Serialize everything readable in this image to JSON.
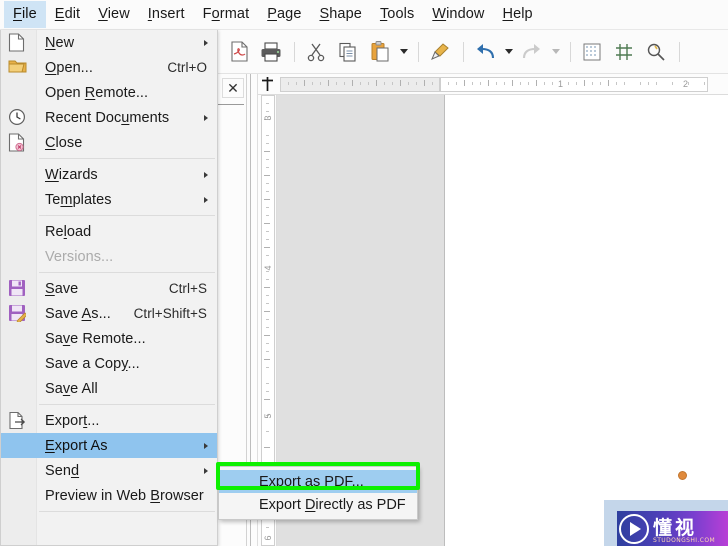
{
  "app": {
    "menubar": [
      {
        "label": "File",
        "mnemonic": "F",
        "active": true
      },
      {
        "label": "Edit",
        "mnemonic": "E",
        "active": false
      },
      {
        "label": "View",
        "mnemonic": "V",
        "active": false
      },
      {
        "label": "Insert",
        "mnemonic": "I",
        "active": false
      },
      {
        "label": "Format",
        "mnemonic": "o",
        "active": false
      },
      {
        "label": "Page",
        "mnemonic": "P",
        "active": false
      },
      {
        "label": "Shape",
        "mnemonic": "S",
        "active": false
      },
      {
        "label": "Tools",
        "mnemonic": "T",
        "active": false
      },
      {
        "label": "Window",
        "mnemonic": "W",
        "active": false
      },
      {
        "label": "Help",
        "mnemonic": "H",
        "active": false
      }
    ]
  },
  "toolbar": {
    "buttons": [
      {
        "icon": "export-pdf-icon",
        "tooltip": "Export as PDF"
      },
      {
        "icon": "print-icon",
        "tooltip": "Print"
      },
      {
        "icon": "cut-icon",
        "tooltip": "Cut"
      },
      {
        "icon": "copy-icon",
        "tooltip": "Copy"
      },
      {
        "icon": "paste-icon",
        "tooltip": "Paste"
      },
      {
        "icon": "clone-formatting-icon",
        "tooltip": "Clone Formatting"
      },
      {
        "icon": "undo-icon",
        "tooltip": "Undo"
      },
      {
        "icon": "redo-icon",
        "tooltip": "Redo"
      },
      {
        "icon": "display-grid-icon",
        "tooltip": "Display Grid"
      },
      {
        "icon": "snap-to-grid-icon",
        "tooltip": "Snap to Grid"
      },
      {
        "icon": "zoom-icon",
        "tooltip": "Zoom"
      }
    ]
  },
  "sidepanel": {
    "close_label": "✕"
  },
  "file_menu": {
    "items": [
      {
        "type": "item",
        "label": "New",
        "mnemonic": "N",
        "icon": "new-document-icon",
        "shortcut": "",
        "submenu": true,
        "disabled": false,
        "highlight": false
      },
      {
        "type": "item",
        "label": "Open...",
        "mnemonic": "O",
        "icon": "open-folder-icon",
        "shortcut": "Ctrl+O",
        "submenu": false,
        "disabled": false,
        "highlight": false
      },
      {
        "type": "item",
        "label": "Open Remote...",
        "mnemonic": "R",
        "icon": "",
        "shortcut": "",
        "submenu": false,
        "disabled": false,
        "highlight": false
      },
      {
        "type": "item",
        "label": "Recent Documents",
        "mnemonic": "u",
        "icon": "clock-icon",
        "shortcut": "",
        "submenu": true,
        "disabled": false,
        "highlight": false
      },
      {
        "type": "item",
        "label": "Close",
        "mnemonic": "C",
        "icon": "close-document-icon",
        "shortcut": "",
        "submenu": false,
        "disabled": false,
        "highlight": false
      },
      {
        "type": "separator"
      },
      {
        "type": "item",
        "label": "Wizards",
        "mnemonic": "W",
        "icon": "",
        "shortcut": "",
        "submenu": true,
        "disabled": false,
        "highlight": false
      },
      {
        "type": "item",
        "label": "Templates",
        "mnemonic": "m",
        "icon": "",
        "shortcut": "",
        "submenu": true,
        "disabled": false,
        "highlight": false
      },
      {
        "type": "separator"
      },
      {
        "type": "item",
        "label": "Reload",
        "mnemonic": "l",
        "icon": "",
        "shortcut": "",
        "submenu": false,
        "disabled": false,
        "highlight": false
      },
      {
        "type": "item",
        "label": "Versions...",
        "mnemonic": "",
        "icon": "",
        "shortcut": "",
        "submenu": false,
        "disabled": true,
        "highlight": false
      },
      {
        "type": "separator"
      },
      {
        "type": "item",
        "label": "Save",
        "mnemonic": "S",
        "icon": "save-icon",
        "shortcut": "Ctrl+S",
        "submenu": false,
        "disabled": false,
        "highlight": false
      },
      {
        "type": "item",
        "label": "Save As...",
        "mnemonic": "A",
        "icon": "save-as-icon",
        "shortcut": "Ctrl+Shift+S",
        "submenu": false,
        "disabled": false,
        "highlight": false
      },
      {
        "type": "item",
        "label": "Save Remote...",
        "mnemonic": "v",
        "icon": "",
        "shortcut": "",
        "submenu": false,
        "disabled": false,
        "highlight": false
      },
      {
        "type": "item",
        "label": "Save a Copy...",
        "mnemonic": "y",
        "icon": "",
        "shortcut": "",
        "submenu": false,
        "disabled": false,
        "highlight": false
      },
      {
        "type": "item",
        "label": "Save All",
        "mnemonic": "v",
        "icon": "",
        "shortcut": "",
        "submenu": false,
        "disabled": false,
        "highlight": false
      },
      {
        "type": "separator"
      },
      {
        "type": "item",
        "label": "Export...",
        "mnemonic": "t",
        "icon": "export-icon",
        "shortcut": "",
        "submenu": false,
        "disabled": false,
        "highlight": false
      },
      {
        "type": "item",
        "label": "Export As",
        "mnemonic": "E",
        "icon": "",
        "shortcut": "",
        "submenu": true,
        "disabled": false,
        "highlight": true
      },
      {
        "type": "item",
        "label": "Send",
        "mnemonic": "d",
        "icon": "",
        "shortcut": "",
        "submenu": true,
        "disabled": false,
        "highlight": false
      },
      {
        "type": "item",
        "label": "Preview in Web Browser",
        "mnemonic": "B",
        "icon": "",
        "shortcut": "",
        "submenu": false,
        "disabled": false,
        "highlight": false
      }
    ]
  },
  "export_submenu": {
    "items": [
      {
        "label": "Export as PDF...",
        "mnemonic": "E",
        "highlight": true
      },
      {
        "label": "Export Directly as PDF",
        "mnemonic": "D",
        "highlight": false
      }
    ]
  },
  "annotation": {
    "color": "#0df000",
    "target": "Export as PDF..."
  },
  "rulers": {
    "horizontal": {
      "unit": "inch",
      "numbers": [
        "1",
        "2"
      ]
    },
    "vertical": {
      "unit": "inch",
      "numbers": [
        "3",
        "4",
        "5",
        "6"
      ]
    }
  },
  "watermark": {
    "title": "懂视",
    "subtitle": "STUDONGSHI.COM",
    "icon": "play-circle-icon"
  }
}
